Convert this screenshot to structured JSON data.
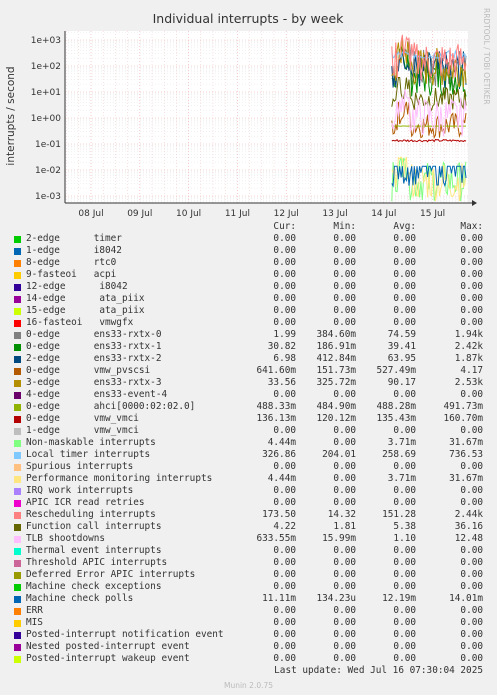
{
  "chart_data": {
    "type": "line",
    "title": "Individual interrupts - by week",
    "ylabel": "interrupts / second",
    "yscale": "log",
    "ylim": [
      0.0005,
      2000
    ],
    "y_ticks": [
      "1e-03",
      "1e-02",
      "1e-01",
      "1e+00",
      "1e+01",
      "1e+02",
      "1e+03"
    ],
    "x_ticks": [
      "08 Jul",
      "09 Jul",
      "10 Jul",
      "11 Jul",
      "12 Jul",
      "13 Jul",
      "14 Jul",
      "15 Jul"
    ],
    "data_start_label": "14 Jul",
    "side_text": "RRDTOOL / TOBI OETIKER",
    "legend_headers": [
      "Cur:",
      "Min:",
      "Avg:",
      "Max:"
    ],
    "series": [
      {
        "name": "2-edge      timer",
        "color": "#00cc00",
        "cur": "0.00",
        "min": "0.00",
        "avg": "0.00",
        "max": "0.00"
      },
      {
        "name": "1-edge      i8042",
        "color": "#0066b3",
        "cur": "0.00",
        "min": "0.00",
        "avg": "0.00",
        "max": "0.00"
      },
      {
        "name": "8-edge      rtc0",
        "color": "#ff8000",
        "cur": "0.00",
        "min": "0.00",
        "avg": "0.00",
        "max": "0.00"
      },
      {
        "name": "9-fasteoi   acpi",
        "color": "#ffcc00",
        "cur": "0.00",
        "min": "0.00",
        "avg": "0.00",
        "max": "0.00"
      },
      {
        "name": "12-edge      i8042",
        "color": "#330099",
        "cur": "0.00",
        "min": "0.00",
        "avg": "0.00",
        "max": "0.00"
      },
      {
        "name": "14-edge      ata_piix",
        "color": "#990099",
        "cur": "0.00",
        "min": "0.00",
        "avg": "0.00",
        "max": "0.00"
      },
      {
        "name": "15-edge      ata_piix",
        "color": "#ccff00",
        "cur": "0.00",
        "min": "0.00",
        "avg": "0.00",
        "max": "0.00"
      },
      {
        "name": "16-fasteoi   vmwgfx",
        "color": "#ff0000",
        "cur": "0.00",
        "min": "0.00",
        "avg": "0.00",
        "max": "0.00"
      },
      {
        "name": "0-edge      ens33-rxtx-0",
        "color": "#808080",
        "cur": "1.99",
        "min": "384.60m",
        "avg": "74.59",
        "max": "1.94k"
      },
      {
        "name": "0-edge      ens33-rxtx-1",
        "color": "#008f00",
        "cur": "30.82",
        "min": "186.91m",
        "avg": "39.41",
        "max": "2.42k"
      },
      {
        "name": "2-edge      ens33-rxtx-2",
        "color": "#00487d",
        "cur": "6.98",
        "min": "412.84m",
        "avg": "63.95",
        "max": "1.87k"
      },
      {
        "name": "0-edge      vmw_pvscsi",
        "color": "#b35a00",
        "cur": "641.60m",
        "min": "151.73m",
        "avg": "527.49m",
        "max": "4.17"
      },
      {
        "name": "3-edge      ens33-rxtx-3",
        "color": "#b38f00",
        "cur": "33.56",
        "min": "325.72m",
        "avg": "90.17",
        "max": "2.53k"
      },
      {
        "name": "4-edge      ens33-event-4",
        "color": "#6b006b",
        "cur": "0.00",
        "min": "0.00",
        "avg": "0.00",
        "max": "0.00"
      },
      {
        "name": "0-edge      ahci[0000:02:02.0]",
        "color": "#8fb300",
        "cur": "488.33m",
        "min": "484.90m",
        "avg": "488.28m",
        "max": "491.73m"
      },
      {
        "name": "0-edge      vmw_vmci",
        "color": "#b30000",
        "cur": "136.13m",
        "min": "120.12m",
        "avg": "135.43m",
        "max": "160.70m"
      },
      {
        "name": "1-edge      vmw_vmci",
        "color": "#bebebe",
        "cur": "0.00",
        "min": "0.00",
        "avg": "0.00",
        "max": "0.00"
      },
      {
        "name": "Non-maskable interrupts",
        "color": "#80ff80",
        "cur": "4.44m",
        "min": "0.00",
        "avg": "3.71m",
        "max": "31.67m"
      },
      {
        "name": "Local timer interrupts",
        "color": "#80c9ff",
        "cur": "326.86",
        "min": "204.01",
        "avg": "258.69",
        "max": "736.53"
      },
      {
        "name": "Spurious interrupts",
        "color": "#ffc080",
        "cur": "0.00",
        "min": "0.00",
        "avg": "0.00",
        "max": "0.00"
      },
      {
        "name": "Performance monitoring interrupts",
        "color": "#ffe680",
        "cur": "4.44m",
        "min": "0.00",
        "avg": "3.71m",
        "max": "31.67m"
      },
      {
        "name": "IRQ work interrupts",
        "color": "#aa80ff",
        "cur": "0.00",
        "min": "0.00",
        "avg": "0.00",
        "max": "0.00"
      },
      {
        "name": "APIC ICR read retries",
        "color": "#ee00cc",
        "cur": "0.00",
        "min": "0.00",
        "avg": "0.00",
        "max": "0.00"
      },
      {
        "name": "Rescheduling interrupts",
        "color": "#ff8080",
        "cur": "173.50",
        "min": "14.32",
        "avg": "151.28",
        "max": "2.44k"
      },
      {
        "name": "Function call interrupts",
        "color": "#666600",
        "cur": "4.22",
        "min": "1.81",
        "avg": "5.38",
        "max": "36.16"
      },
      {
        "name": "TLB shootdowns",
        "color": "#ffbfff",
        "cur": "633.55m",
        "min": "15.99m",
        "avg": "1.10",
        "max": "12.48"
      },
      {
        "name": "Thermal event interrupts",
        "color": "#00ffcc",
        "cur": "0.00",
        "min": "0.00",
        "avg": "0.00",
        "max": "0.00"
      },
      {
        "name": "Threshold APIC interrupts",
        "color": "#cc6699",
        "cur": "0.00",
        "min": "0.00",
        "avg": "0.00",
        "max": "0.00"
      },
      {
        "name": "Deferred Error APIC interrupts",
        "color": "#999900",
        "cur": "0.00",
        "min": "0.00",
        "avg": "0.00",
        "max": "0.00"
      },
      {
        "name": "Machine check exceptions",
        "color": "#00cc00",
        "cur": "0.00",
        "min": "0.00",
        "avg": "0.00",
        "max": "0.00"
      },
      {
        "name": "Machine check polls",
        "color": "#0066b3",
        "cur": "11.11m",
        "min": "134.23u",
        "avg": "12.19m",
        "max": "14.01m"
      },
      {
        "name": "ERR",
        "color": "#ff8000",
        "cur": "0.00",
        "min": "0.00",
        "avg": "0.00",
        "max": "0.00"
      },
      {
        "name": "MIS",
        "color": "#ffcc00",
        "cur": "0.00",
        "min": "0.00",
        "avg": "0.00",
        "max": "0.00"
      },
      {
        "name": "Posted-interrupt notification event",
        "color": "#330099",
        "cur": "0.00",
        "min": "0.00",
        "avg": "0.00",
        "max": "0.00"
      },
      {
        "name": "Nested posted-interrupt event",
        "color": "#990099",
        "cur": "0.00",
        "min": "0.00",
        "avg": "0.00",
        "max": "0.00"
      },
      {
        "name": "Posted-interrupt wakeup event",
        "color": "#ccff00",
        "cur": "0.00",
        "min": "0.00",
        "avg": "0.00",
        "max": "0.00"
      }
    ]
  },
  "footer": {
    "last_update": "Last update: Wed Jul 16 07:30:04 2025",
    "munin_version": "Munin 2.0.75"
  }
}
